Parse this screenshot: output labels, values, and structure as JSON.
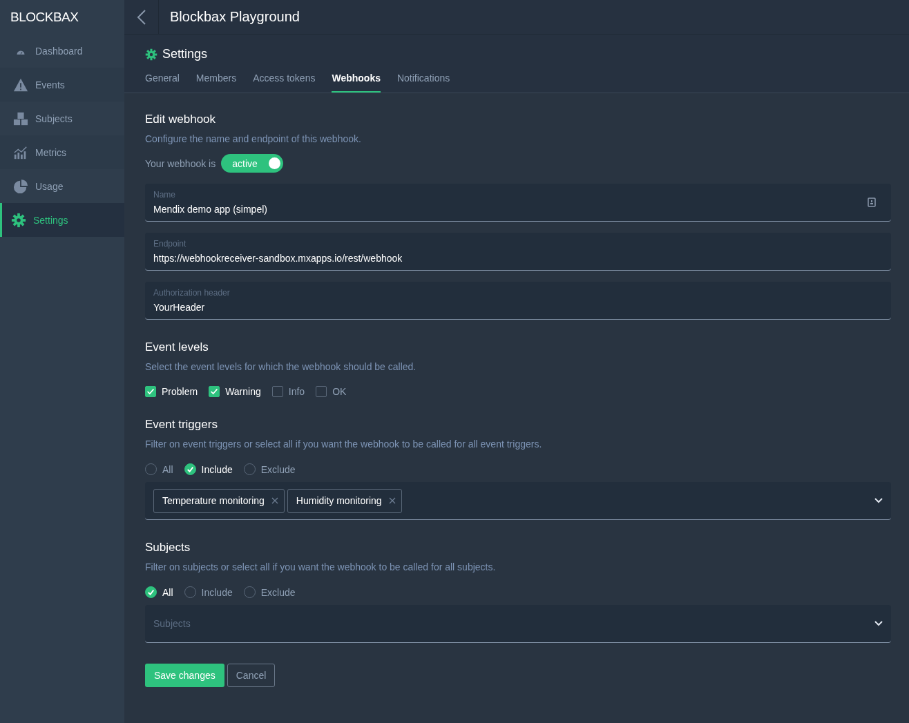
{
  "logo": "BLOCKBAX",
  "sidebar": {
    "items": [
      {
        "label": "Dashboard",
        "kind": "gauge",
        "selected": false
      },
      {
        "label": "Events",
        "kind": "warning",
        "selected": false
      },
      {
        "label": "Subjects",
        "kind": "blocks",
        "selected": false
      },
      {
        "label": "Metrics",
        "kind": "chart",
        "selected": false
      },
      {
        "label": "Usage",
        "kind": "pie",
        "selected": false
      },
      {
        "label": "Settings",
        "kind": "gear",
        "selected": true
      }
    ]
  },
  "header": {
    "title": "Blockbax Playground"
  },
  "page": {
    "title": "Settings",
    "tabs": [
      {
        "label": "General",
        "selected": false
      },
      {
        "label": "Members",
        "selected": false
      },
      {
        "label": "Access tokens",
        "selected": false
      },
      {
        "label": "Webhooks",
        "selected": true
      },
      {
        "label": "Notifications",
        "selected": false
      }
    ]
  },
  "edit": {
    "title": "Edit webhook",
    "description": "Configure the name and endpoint of this webhook.",
    "status_label": "Your webhook is",
    "toggle": {
      "label": "active",
      "on": true
    },
    "fields": [
      {
        "label": "Name",
        "value": "Mendix demo app (simpel)",
        "has_icon": true
      },
      {
        "label": "Endpoint",
        "value": "https://webhookreceiver-sandbox.mxapps.io/rest/webhook",
        "has_icon": false
      },
      {
        "label": "Authorization header",
        "value": "YourHeader",
        "has_icon": false
      }
    ]
  },
  "event_levels": {
    "title": "Event levels",
    "description": "Select the event levels for which the webhook should be called.",
    "options": [
      {
        "label": "Problem",
        "checked": true
      },
      {
        "label": "Warning",
        "checked": true
      },
      {
        "label": "Info",
        "checked": false
      },
      {
        "label": "OK",
        "checked": false
      }
    ]
  },
  "event_triggers": {
    "title": "Event triggers",
    "description": "Filter on event triggers or select all if you want the webhook to be called for all event triggers.",
    "options": [
      {
        "label": "All",
        "selected": false
      },
      {
        "label": "Include",
        "selected": true
      },
      {
        "label": "Exclude",
        "selected": false
      }
    ],
    "tags": [
      "Temperature monitoring",
      "Humidity monitoring"
    ]
  },
  "subjects": {
    "title": "Subjects",
    "description": "Filter on subjects or select all if you want the webhook to be called for all subjects.",
    "options": [
      {
        "label": "All",
        "selected": true
      },
      {
        "label": "Include",
        "selected": false
      },
      {
        "label": "Exclude",
        "selected": false
      }
    ],
    "placeholder": "Subjects"
  },
  "buttons": {
    "save": "Save changes",
    "cancel": "Cancel"
  }
}
